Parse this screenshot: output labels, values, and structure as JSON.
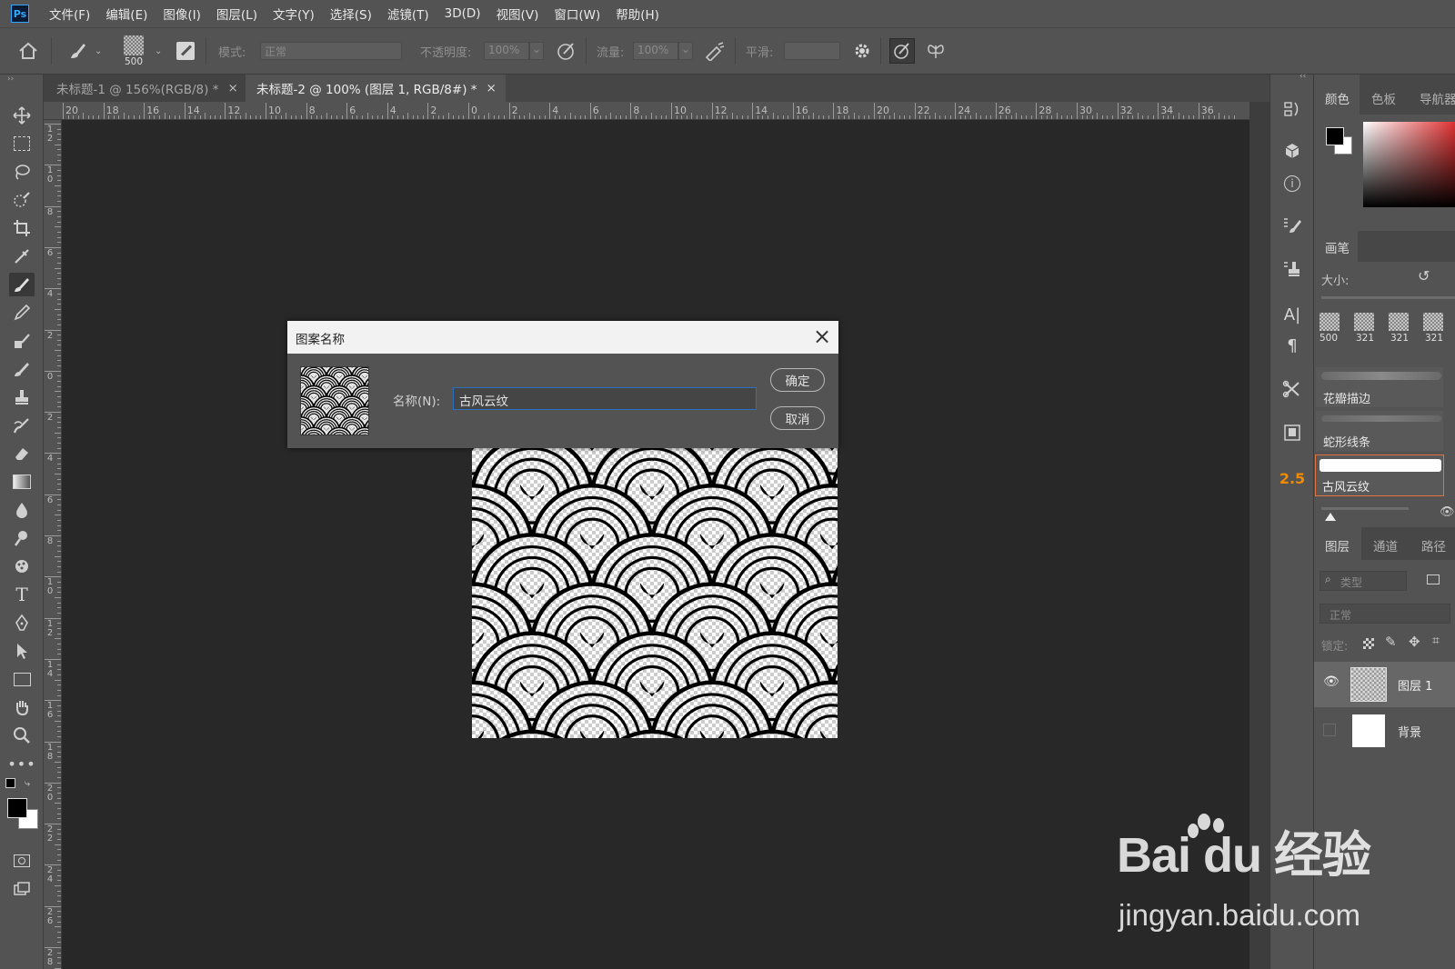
{
  "app": {
    "logo": "Ps"
  },
  "menu": [
    "文件(F)",
    "编辑(E)",
    "图像(I)",
    "图层(L)",
    "文字(Y)",
    "选择(S)",
    "滤镜(T)",
    "3D(D)",
    "视图(V)",
    "窗口(W)",
    "帮助(H)"
  ],
  "options": {
    "brush_size": "500",
    "mode_label": "模式:",
    "mode_value": "正常",
    "opacity_label": "不透明度:",
    "opacity_value": "100%",
    "flow_label": "流量:",
    "flow_value": "100%",
    "smooth_label": "平滑:"
  },
  "tabs": [
    {
      "label": "未标题-1 @ 156%(RGB/8) *",
      "close": "×"
    },
    {
      "label": "未标题-2 @ 100% (图层 1, RGB/8#) *",
      "close": "×"
    }
  ],
  "ruler": {
    "h": [
      "20",
      "18",
      "16",
      "14",
      "12",
      "10",
      "8",
      "6",
      "4",
      "2",
      "0",
      "2",
      "4",
      "6",
      "8",
      "10",
      "12",
      "14",
      "16",
      "18",
      "20",
      "22",
      "24",
      "26",
      "28",
      "30",
      "32",
      "34",
      "36"
    ],
    "v": [
      "12",
      "10",
      "8",
      "6",
      "4",
      "2",
      "0",
      "2",
      "4",
      "6",
      "8",
      "10",
      "12",
      "14",
      "16",
      "18",
      "20",
      "22",
      "24",
      "26",
      "28"
    ]
  },
  "dialog": {
    "title": "图案名称",
    "name_label": "名称(N):",
    "name_value": "古风云纹",
    "ok_label": "确定",
    "cancel_label": "取消",
    "close": "×"
  },
  "panels": {
    "color_tabs": [
      "颜色",
      "色板",
      "导航器"
    ],
    "brush_title": "画笔",
    "size_label": "大小:",
    "presets": [
      "500",
      "321",
      "321",
      "321"
    ],
    "brush_items": [
      "花瓣描边",
      "蛇形线条",
      "古风云纹"
    ],
    "layer_tabs": [
      "图层",
      "通道",
      "路径"
    ],
    "filter_placeholder": "类型",
    "blend_mode": "正常",
    "lock_label": "锁定:",
    "layers": [
      {
        "name": "图层 1",
        "visible": true
      },
      {
        "name": "背景",
        "visible": false
      }
    ]
  },
  "strip_value": "2.5",
  "watermark": {
    "logo": "Bai du 经验",
    "url": "jingyan.baidu.com"
  },
  "colors": {
    "accent": "#31a8ff",
    "highlight_orange": "#f08a00",
    "selected_brush_border": "#e0743a"
  }
}
